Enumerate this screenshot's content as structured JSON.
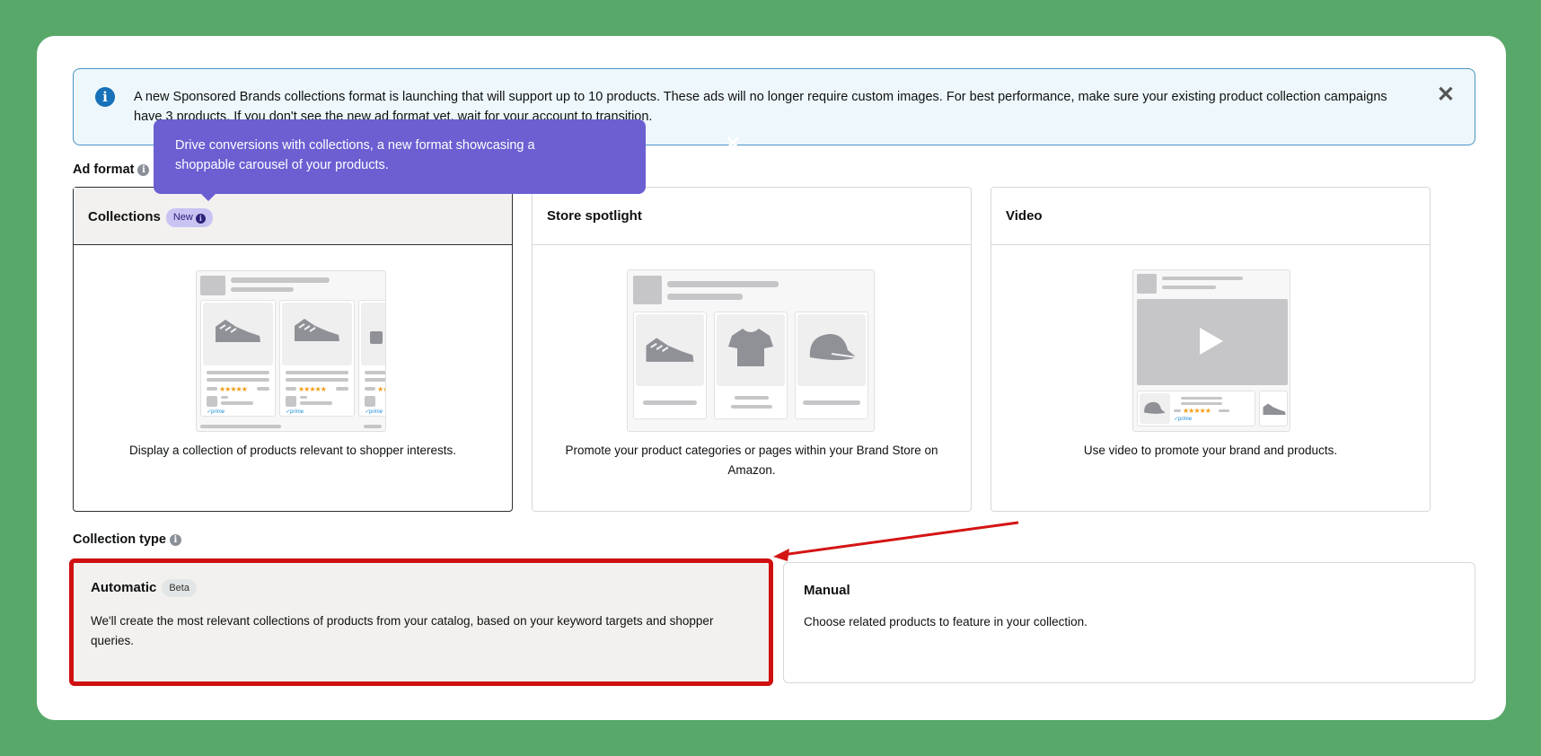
{
  "banner": {
    "text": "A new Sponsored Brands collections format is launching that will support up to 10 products. These ads will no longer require custom images. For best performance, make sure your existing product collection campaigns have 3 products. If you don't see the new ad format yet, wait for your account to transition.",
    "close": "✕"
  },
  "tooltip": {
    "text": "Drive conversions with collections, a new format showcasing a shoppable carousel of your products.",
    "close": "✕"
  },
  "ad_format": {
    "label": "Ad format",
    "cards": [
      {
        "title": "Collections",
        "badge": "New",
        "description": "Display a collection of products relevant to shopper interests.",
        "selected": true
      },
      {
        "title": "Store spotlight",
        "description": "Promote your product categories or pages within your Brand Store on Amazon.",
        "selected": false
      },
      {
        "title": "Video",
        "description": "Use video to promote your brand and products.",
        "selected": false
      }
    ]
  },
  "collection_type": {
    "label": "Collection type",
    "options": [
      {
        "title": "Automatic",
        "badge": "Beta",
        "description": "We'll create the most relevant collections of products from your catalog, based on your keyword targets and shopper queries.",
        "selected": true
      },
      {
        "title": "Manual",
        "description": "Choose related products to feature in your collection.",
        "selected": false
      }
    ]
  },
  "mock": {
    "stars": "★★★★★",
    "prime": "✓prime"
  },
  "colors": {
    "background": "#58a86a",
    "tooltip": "#6b5fd2",
    "banner_border": "#4a93c4",
    "highlight": "#cf1010"
  },
  "icons": {
    "info": "info-icon",
    "close": "close-icon",
    "shoe": "shoe-icon",
    "tshirt": "tshirt-icon",
    "cap": "cap-icon",
    "play": "play-icon"
  }
}
